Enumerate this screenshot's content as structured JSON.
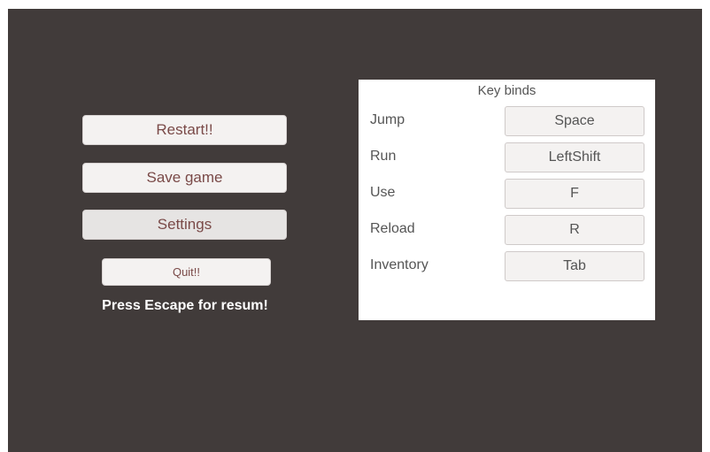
{
  "pause_menu": {
    "restart_label": "Restart!!",
    "save_label": "Save game",
    "settings_label": "Settings",
    "quit_label": "Quit!!",
    "hint_text": "Press Escape for resum!"
  },
  "key_binds": {
    "title": "Key binds",
    "rows": [
      {
        "action": "Jump",
        "key": "Space"
      },
      {
        "action": "Run",
        "key": "LeftShift"
      },
      {
        "action": "Use",
        "key": "F"
      },
      {
        "action": "Reload",
        "key": "R"
      },
      {
        "action": "Inventory",
        "key": "Tab"
      }
    ]
  },
  "colors": {
    "background": "#413b3a",
    "button_text": "#7a4a48",
    "panel": "#ffffff"
  }
}
